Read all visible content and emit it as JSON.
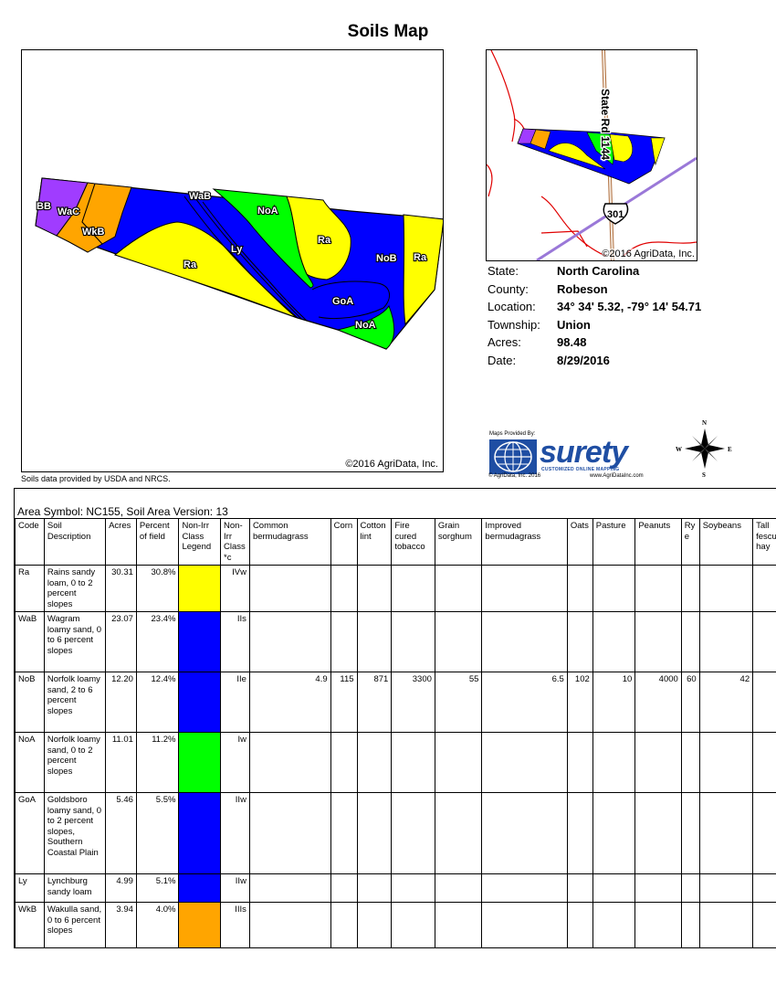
{
  "page": {
    "title": "Soils Map"
  },
  "main_map": {
    "copyright": "©2016 AgriData, Inc.",
    "labels": [
      "BB",
      "WaC",
      "WkB",
      "WaB",
      "Ra",
      "Ly",
      "NoA",
      "Ra",
      "NoB",
      "Ra",
      "GoA",
      "NoA"
    ]
  },
  "source_note": "Soils data provided by USDA and NRCS.",
  "inset_map": {
    "copyright": "©2016 AgriData, Inc.",
    "road_label": "State Rd 1144",
    "highway_shield": "301"
  },
  "info": {
    "rows": [
      {
        "label": "State:",
        "value": "North Carolina"
      },
      {
        "label": "County:",
        "value": "Robeson"
      },
      {
        "label": "Location:",
        "value": "34° 34' 5.32,  -79° 14' 54.71"
      },
      {
        "label": "Township:",
        "value": "Union"
      },
      {
        "label": "Acres:",
        "value": "98.48"
      },
      {
        "label": "Date:",
        "value": "8/29/2016"
      }
    ]
  },
  "logo": {
    "provided_by": "Maps Provided By:",
    "name": "surety",
    "tagline": "CUSTOMIZED ONLINE MAPPING",
    "footer_left": "© AgriData, Inc. 2016",
    "footer_right": "www.AgriDataInc.com"
  },
  "compass": {
    "n": "N",
    "s": "S",
    "e": "E",
    "w": "W"
  },
  "table": {
    "area_symbol": "Area Symbol: NC155, Soil Area Version: 13",
    "headers": [
      "Code",
      "Soil Description",
      "Acres",
      "Percent of field",
      "Non-Irr Class Legend",
      "Non-Irr Class *c",
      "Common bermudagrass",
      "Corn",
      "Cotton lint",
      "Fire cured tobacco",
      "Grain sorghum",
      "Improved bermudagrass",
      "Oats",
      "Pasture",
      "Peanuts",
      "Ry e",
      "Soybeans",
      "Tall fescue hay"
    ],
    "rows": [
      {
        "code": "Ra",
        "desc": "Rains sandy loam, 0 to 2 percent slopes",
        "acres": "30.31",
        "pct": "30.8%",
        "color": "#ffff00",
        "cls": "IVw",
        "vals": [
          "",
          "",
          "",
          "",
          "",
          "",
          "",
          "",
          "",
          "",
          "",
          ""
        ]
      },
      {
        "code": "WaB",
        "desc": "Wagram loamy sand, 0 to 6 percent slopes",
        "acres": "23.07",
        "pct": "23.4%",
        "color": "#0000ff",
        "cls": "IIs",
        "vals": [
          "",
          "",
          "",
          "",
          "",
          "",
          "",
          "",
          "",
          "",
          "",
          ""
        ]
      },
      {
        "code": "NoB",
        "desc": "Norfolk loamy sand, 2 to 6 percent slopes",
        "acres": "12.20",
        "pct": "12.4%",
        "color": "#0000ff",
        "cls": "IIe",
        "vals": [
          "4.9",
          "115",
          "871",
          "3300",
          "55",
          "6.5",
          "102",
          "10",
          "4000",
          "60",
          "42",
          ""
        ]
      },
      {
        "code": "NoA",
        "desc": "Norfolk loamy sand, 0 to 2 percent slopes",
        "acres": "11.01",
        "pct": "11.2%",
        "color": "#00ff00",
        "cls": "Iw",
        "vals": [
          "",
          "",
          "",
          "",
          "",
          "",
          "",
          "",
          "",
          "",
          "",
          ""
        ]
      },
      {
        "code": "GoA",
        "desc": "Goldsboro loamy sand, 0 to 2 percent slopes, Southern Coastal Plain",
        "acres": "5.46",
        "pct": "5.5%",
        "color": "#0000ff",
        "cls": "IIw",
        "vals": [
          "",
          "",
          "",
          "",
          "",
          "",
          "",
          "",
          "",
          "",
          "",
          ""
        ]
      },
      {
        "code": "Ly",
        "desc": "Lynchburg sandy loam",
        "acres": "4.99",
        "pct": "5.1%",
        "color": "#0000ff",
        "cls": "IIw",
        "vals": [
          "",
          "",
          "",
          "",
          "",
          "",
          "",
          "",
          "",
          "",
          "",
          ""
        ]
      },
      {
        "code": "WkB",
        "desc": "Wakulla sand, 0 to 6 percent slopes",
        "acres": "3.94",
        "pct": "4.0%",
        "color": "#ffa500",
        "cls": "IIIs",
        "vals": [
          "",
          "",
          "",
          "",
          "",
          "",
          "",
          "",
          "",
          "",
          "",
          ""
        ]
      }
    ]
  }
}
